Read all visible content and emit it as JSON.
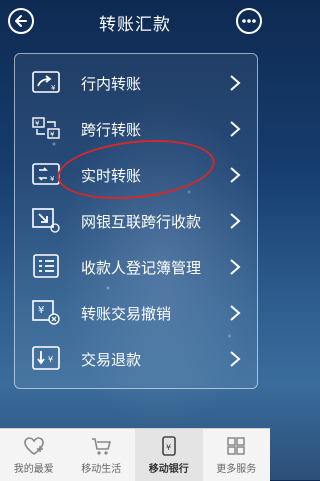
{
  "header": {
    "title": "转账汇款",
    "back_icon": "arrow-left-icon",
    "more_icon": "more-dots-icon"
  },
  "menu": [
    {
      "label": "行内转账",
      "icon": "transfer-arrow-icon"
    },
    {
      "label": "跨行转账",
      "icon": "cross-bank-icon"
    },
    {
      "label": "实时转账",
      "icon": "realtime-transfer-icon"
    },
    {
      "label": "网银互联跨行收款",
      "icon": "receive-download-icon"
    },
    {
      "label": "收款人登记簿管理",
      "icon": "payee-book-icon"
    },
    {
      "label": "转账交易撤销",
      "icon": "cancel-transfer-icon"
    },
    {
      "label": "交易退款",
      "icon": "refund-icon"
    }
  ],
  "tabs": [
    {
      "label": "我的最爱",
      "icon": "heart-icon",
      "active": false
    },
    {
      "label": "移动生活",
      "icon": "cart-icon",
      "active": false
    },
    {
      "label": "移动银行",
      "icon": "mobile-bank-icon",
      "active": true
    },
    {
      "label": "更多服务",
      "icon": "grid-icon",
      "active": false
    }
  ],
  "colors": {
    "highlight": "#d12a2a"
  }
}
